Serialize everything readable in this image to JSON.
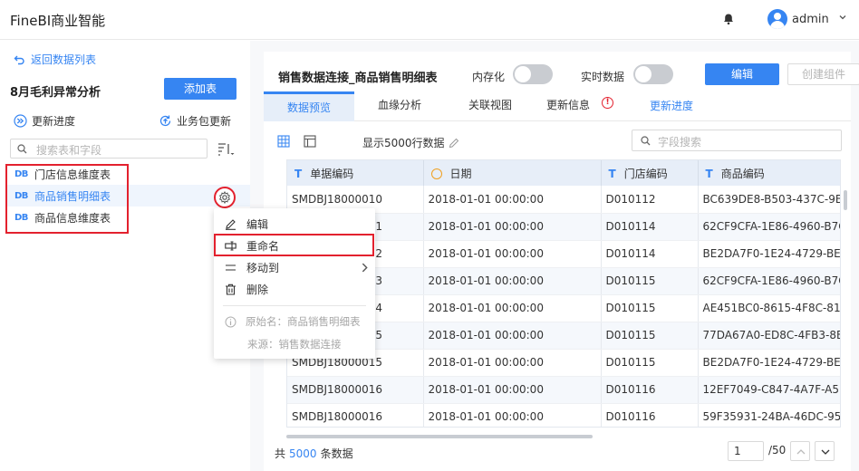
{
  "app": {
    "brand": "FineBI商业智能",
    "user": "admin"
  },
  "left": {
    "back_label": "返回数据列表",
    "package_title": "8月毛利异常分析",
    "add_table_label": "添加表",
    "update_progress_label": "更新进度",
    "package_update_label": "业务包更新",
    "search_placeholder": "搜索表和字段",
    "db_tag": "DB",
    "tables": [
      {
        "label": "门店信息维度表"
      },
      {
        "label": "商品销售明细表"
      },
      {
        "label": "商品信息维度表"
      }
    ]
  },
  "menu": {
    "items": [
      {
        "label": "编辑"
      },
      {
        "label": "重命名"
      },
      {
        "label": "移动到"
      },
      {
        "label": "删除"
      }
    ],
    "original_name": "原始名：商品销售明细表",
    "source": "来源：销售数据连接"
  },
  "right": {
    "title": "销售数据连接_商品销售明细表",
    "memory_label": "内存化",
    "realtime_label": "实时数据",
    "edit_label": "编辑",
    "create_label": "创建组件",
    "tabs": [
      {
        "label": "数据预览"
      },
      {
        "label": "血缘分析"
      },
      {
        "label": "关联视图"
      },
      {
        "label": "更新信息"
      },
      {
        "label": "更新进度"
      }
    ],
    "warn_glyph": "!",
    "row_count_label": "显示5000行数据",
    "field_search_placeholder": "字段搜索",
    "columns": [
      {
        "type_glyph": "T",
        "label": "单据编码"
      },
      {
        "type_glyph": "",
        "label": "日期"
      },
      {
        "type_glyph": "T",
        "label": "门店编码"
      },
      {
        "type_glyph": "T",
        "label": "商品编码"
      }
    ],
    "rows": [
      [
        "SMDBJ18000010",
        "2018-01-01 00:00:00",
        "D010112",
        "BC639DE8-B503-437C-9B6"
      ],
      [
        "SMDBJ18000011",
        "2018-01-01 00:00:00",
        "D010114",
        "62CF9CFA-1E86-4960-B7CA"
      ],
      [
        "SMDBJ18000012",
        "2018-01-01 00:00:00",
        "D010114",
        "BE2DA7F0-1E24-4729-BEDS"
      ],
      [
        "SMDBJ18000013",
        "2018-01-01 00:00:00",
        "D010115",
        "62CF9CFA-1E86-4960-B7CA"
      ],
      [
        "SMDBJ18000014",
        "2018-01-01 00:00:00",
        "D010115",
        "AE451BC0-8615-4F8C-8126"
      ],
      [
        "SMDBJ18000015",
        "2018-01-01 00:00:00",
        "D010115",
        "77DA67A0-ED8C-4FB3-8E0"
      ],
      [
        "SMDBJ18000015",
        "2018-01-01 00:00:00",
        "D010115",
        "BE2DA7F0-1E24-4729-BEDS"
      ],
      [
        "SMDBJ18000016",
        "2018-01-01 00:00:00",
        "D010116",
        "12EF7049-C847-4A7F-A5B4"
      ],
      [
        "SMDBJ18000016",
        "2018-01-01 00:00:00",
        "D010116",
        "59F35931-24BA-46DC-9551"
      ]
    ],
    "footer_prefix": "共",
    "footer_count": "5000",
    "footer_suffix": "条数据",
    "page_current": "1",
    "page_total": "/50"
  }
}
